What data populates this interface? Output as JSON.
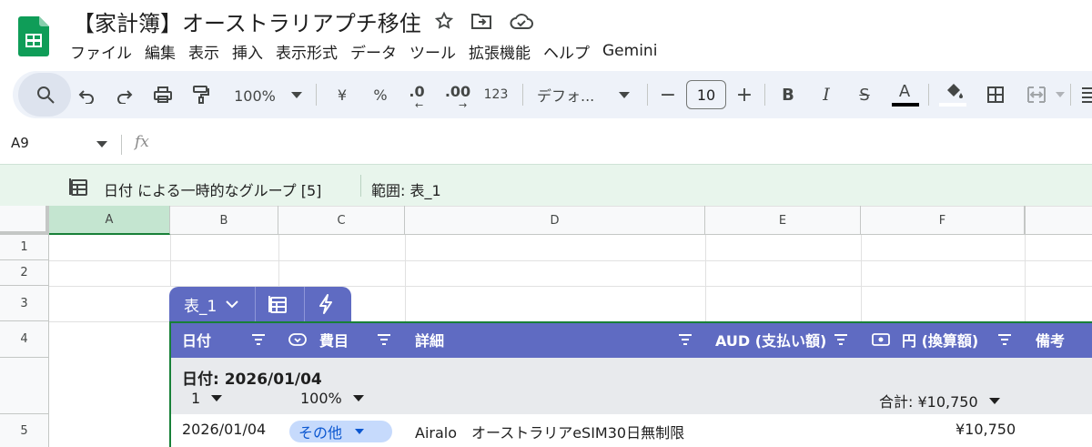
{
  "title": "【家計簿】オーストラリアプチ移住",
  "menu": [
    "ファイル",
    "編集",
    "表示",
    "挿入",
    "表示形式",
    "データ",
    "ツール",
    "拡張機能",
    "ヘルプ",
    "Gemini"
  ],
  "toolbar": {
    "zoom": "100%",
    "currency": "¥",
    "percent": "%",
    "dec_less": ".0",
    "dec_more": ".00",
    "number_format": "123",
    "font": "デフォ...",
    "font_size": "10",
    "minus": "−",
    "plus": "+",
    "bold": "B",
    "italic": "I",
    "strike": "S",
    "text_color_letter": "A",
    "text_color": "#000000"
  },
  "formula_bar": {
    "cell_ref": "A9",
    "fx": "fx"
  },
  "group_banner": {
    "text": "日付 による一時的なグループ [5]",
    "range": "範囲:  表_1"
  },
  "columns": [
    "A",
    "B",
    "C",
    "D",
    "E",
    "F"
  ],
  "rows": [
    "1",
    "2",
    "3",
    "4",
    "5"
  ],
  "table": {
    "name": "表_1",
    "headers": [
      "日付",
      "費目",
      "詳細",
      "AUD (支払い額)",
      "円 (換算額)",
      "備考"
    ],
    "group": {
      "title": "日付: 2026/01/04",
      "count": "1",
      "percent": "100%",
      "sum": "合計: ¥10,750"
    },
    "row": {
      "date": "2026/01/04",
      "category": "その他",
      "detail": "Airalo　オーストラリアeSIM30日無制限",
      "yen": "¥10,750"
    }
  },
  "colors": {
    "table_header": "#5f6bc2",
    "banner": "#e8f5ec",
    "chip": "#c6dafc",
    "accent_green": "#188038"
  }
}
